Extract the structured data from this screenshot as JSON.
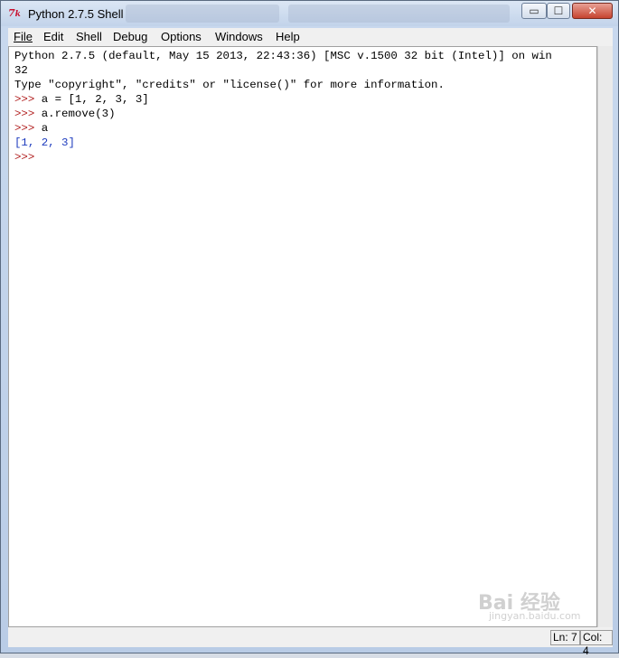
{
  "window": {
    "title": "Python 2.7.5 Shell",
    "icon": "tk-feather-icon",
    "controls": {
      "minimize": "▭",
      "maximize": "☐",
      "close": "✕"
    }
  },
  "menu": {
    "items": [
      {
        "label": "File"
      },
      {
        "label": "Edit"
      },
      {
        "label": "Shell"
      },
      {
        "label": "Debug"
      },
      {
        "label": "Options"
      },
      {
        "label": "Windows"
      },
      {
        "label": "Help"
      }
    ]
  },
  "shell": {
    "lines": [
      "Python 2.7.5 (default, May 15 2013, 22:43:36) [MSC v.1500 32 bit (Intel)] on win",
      "32",
      "Type \"copyright\", \"credits\" or \"license()\" for more information."
    ],
    "session": [
      {
        "prompt": ">>> ",
        "input": "a = [1, 2, 3, 3]"
      },
      {
        "prompt": ">>> ",
        "input": "a.remove(3)"
      },
      {
        "prompt": ">>> ",
        "input": "a"
      },
      {
        "output": "[1, 2, 3]"
      },
      {
        "prompt": ">>> ",
        "input": ""
      }
    ]
  },
  "status": {
    "line": "Ln: 7",
    "col": "Col: 4"
  },
  "watermark": {
    "text": "Bai 经验",
    "sub": "jingyan.baidu.com"
  },
  "colors": {
    "prompt": "#b22222",
    "stdout": "#1e3cbe",
    "background": "#ffffff"
  }
}
